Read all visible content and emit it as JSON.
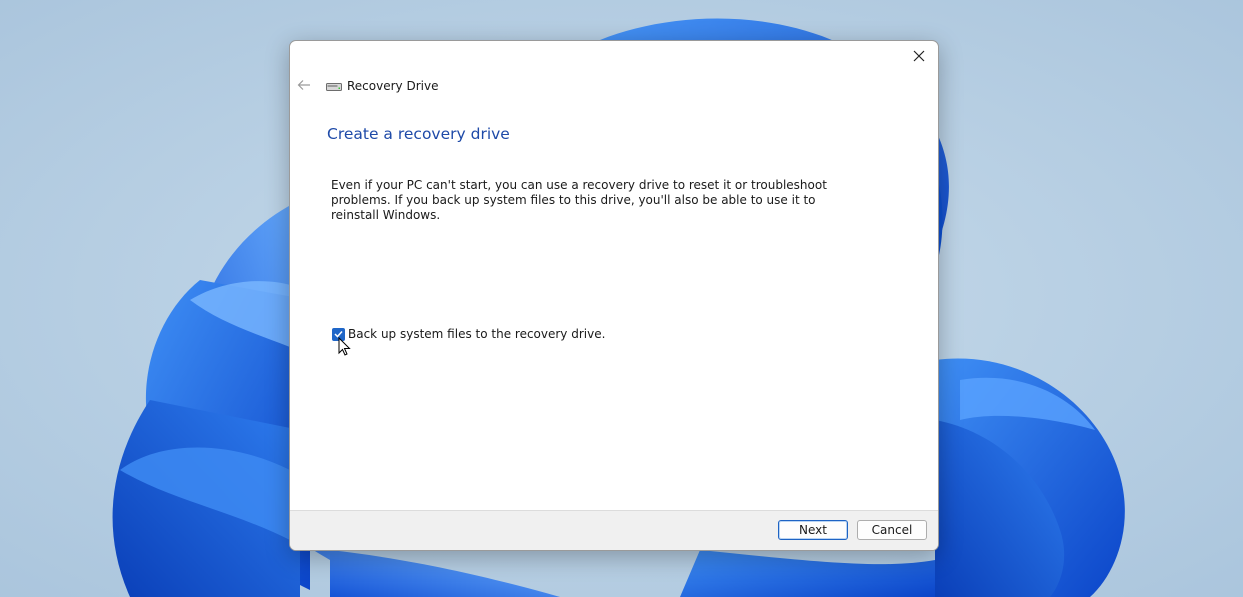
{
  "window": {
    "title": "Recovery Drive",
    "icon": "drive-icon"
  },
  "page": {
    "heading": "Create a recovery drive",
    "description": "Even if your PC can't start, you can use a recovery drive to reset it or troubleshoot problems. If you back up system files to this drive, you'll also be able to use it to reinstall Windows."
  },
  "options": {
    "backup_label": "Back up system files to the recovery drive.",
    "backup_checked": true
  },
  "footer": {
    "next_label": "Next",
    "cancel_label": "Cancel"
  },
  "colors": {
    "accent": "#1f66c8",
    "heading": "#1e4aa8",
    "footer_bg": "#f0f0f0"
  }
}
